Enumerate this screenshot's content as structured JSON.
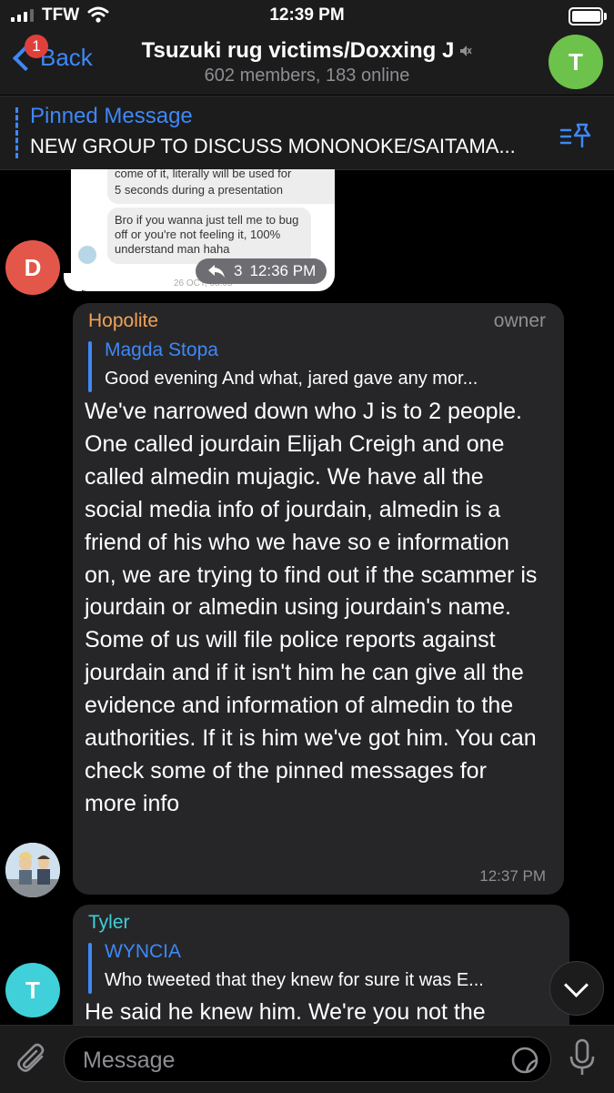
{
  "status_bar": {
    "carrier": "TFW",
    "time": "12:39 PM",
    "battery_level": 0.9
  },
  "header": {
    "back_label": "Back",
    "unread_badge": "1",
    "title": "Tsuzuki rug victims/Doxxing J",
    "subtitle": "602 members, 183 online",
    "avatar_initial": "T",
    "avatar_color": "#6cc24a"
  },
  "pinned": {
    "label": "Pinned Message",
    "text": "NEW GROUP TO DISCUSS MONONOKE/SAITAMA..."
  },
  "screenshot_message": {
    "avatar_initial": "D",
    "avatar_color": "#e3574a",
    "inner_bubble_1": "come of it, literally will be used for 5 seconds during a presentation",
    "inner_bubble_1_line1": "come of it, literally will be used for",
    "inner_bubble_1_line2": "5 seconds during a presentation",
    "inner_bubble_2": "Bro if you wanna just tell me to bug off or you're not feeling it, 100% understand man haha",
    "inner_date": "26 OCT, 08:05",
    "reply_count": "3",
    "time": "12:36 PM"
  },
  "message_hopolite": {
    "sender": "Hopolite",
    "sender_color": "#f0a35a",
    "role": "owner",
    "reply_to_name": "Magda Stopa",
    "reply_to_text": "Good evening  And what, jared gave any mor...",
    "body": "We've narrowed down who J is to 2 people. One called jourdain Elijah Creigh and one called almedin mujagic. We have all the social media info of jourdain, almedin is a friend of his who we have so e information on, we are trying to find out if the scammer is jourdain or almedin using jourdain's name. Some of us will file police reports against jourdain and if it isn't him he can give all the evidence and information of almedin to the authorities. If it is him we've got him. You can check some of the pinned messages for more info",
    "time": "12:37 PM"
  },
  "message_tyler": {
    "sender": "Tyler",
    "sender_color": "#3fd0d9",
    "avatar_initial": "T",
    "reply_to_name": "WYNCIA",
    "reply_to_text": "Who tweeted that they knew for sure it was E...",
    "body": "He said he knew him. We're you not the"
  },
  "input": {
    "placeholder": "Message"
  },
  "icons": [
    "signal-icon",
    "wifi-icon",
    "battery-icon",
    "back-chevron-icon",
    "muted-speaker-icon",
    "pin-list-icon",
    "reply-arrow-icon",
    "chevron-down-icon",
    "paperclip-icon",
    "sticker-icon",
    "microphone-icon"
  ]
}
